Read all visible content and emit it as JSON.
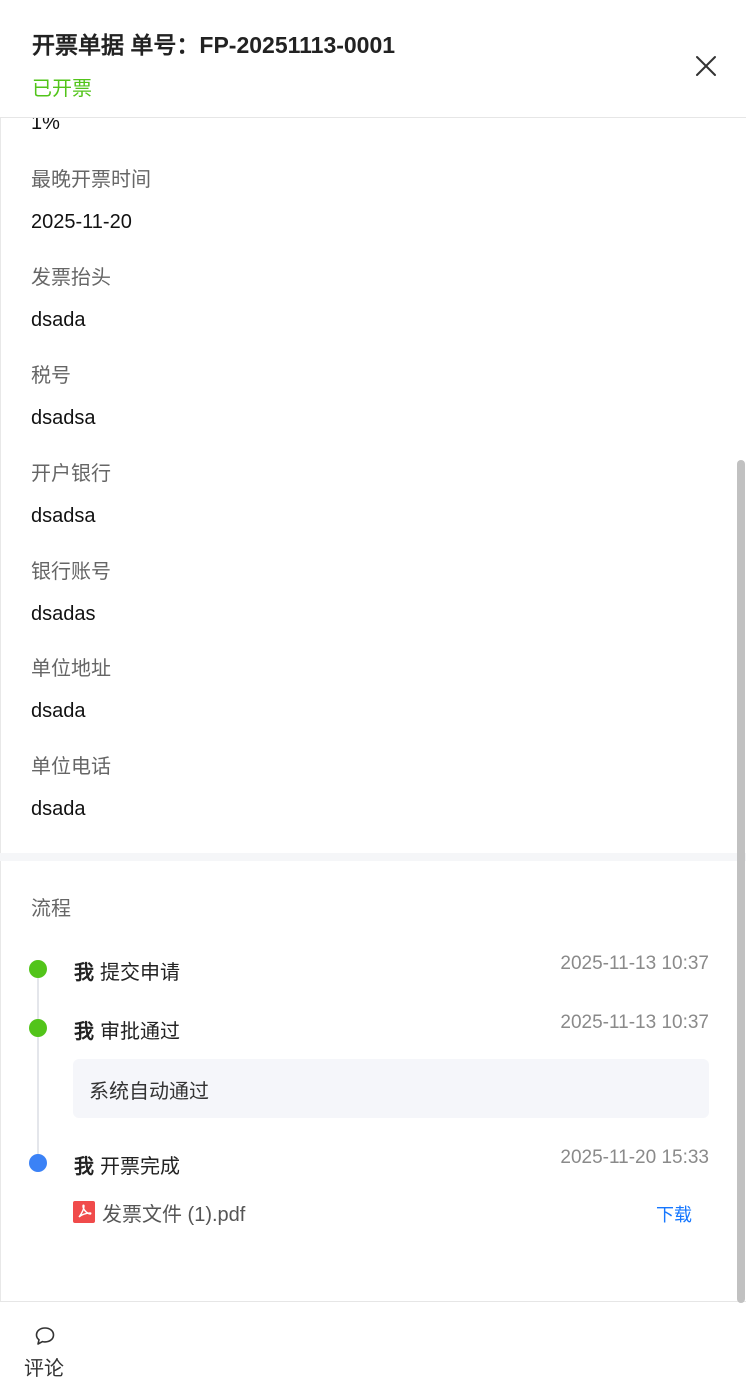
{
  "header": {
    "title": "开票单据 单号：FP-20251113-0001",
    "status": "已开票"
  },
  "fields_partial_value": "1%",
  "fields": [
    {
      "label": "最晚开票时间",
      "value": "2025-11-20"
    },
    {
      "label": "发票抬头",
      "value": "dsada"
    },
    {
      "label": "税号",
      "value": "dsadsa"
    },
    {
      "label": "开户银行",
      "value": "dsadsa"
    },
    {
      "label": "银行账号",
      "value": "dsadas"
    },
    {
      "label": "单位地址",
      "value": "dsada"
    },
    {
      "label": "单位电话",
      "value": "dsada"
    }
  ],
  "process": {
    "title": "流程",
    "steps": [
      {
        "actor": "我",
        "action": "提交申请",
        "time": "2025-11-13 10:37",
        "dot_color": "#52c41a"
      },
      {
        "actor": "我",
        "action": "审批通过",
        "time": "2025-11-13 10:37",
        "dot_color": "#52c41a",
        "comment": "系统自动通过"
      },
      {
        "actor": "我",
        "action": "开票完成",
        "time": "2025-11-20 15:33",
        "dot_color": "#3b82f6",
        "file": {
          "name": "发票文件 (1).pdf",
          "icon": "pdf-file-icon",
          "action_label": "下载"
        }
      }
    ]
  },
  "footer": {
    "comment_label": "评论",
    "comment_icon": "speech-bubble-icon"
  },
  "colors": {
    "success": "#52c41a",
    "primary": "#1677ff",
    "current_step": "#3b82f6"
  }
}
